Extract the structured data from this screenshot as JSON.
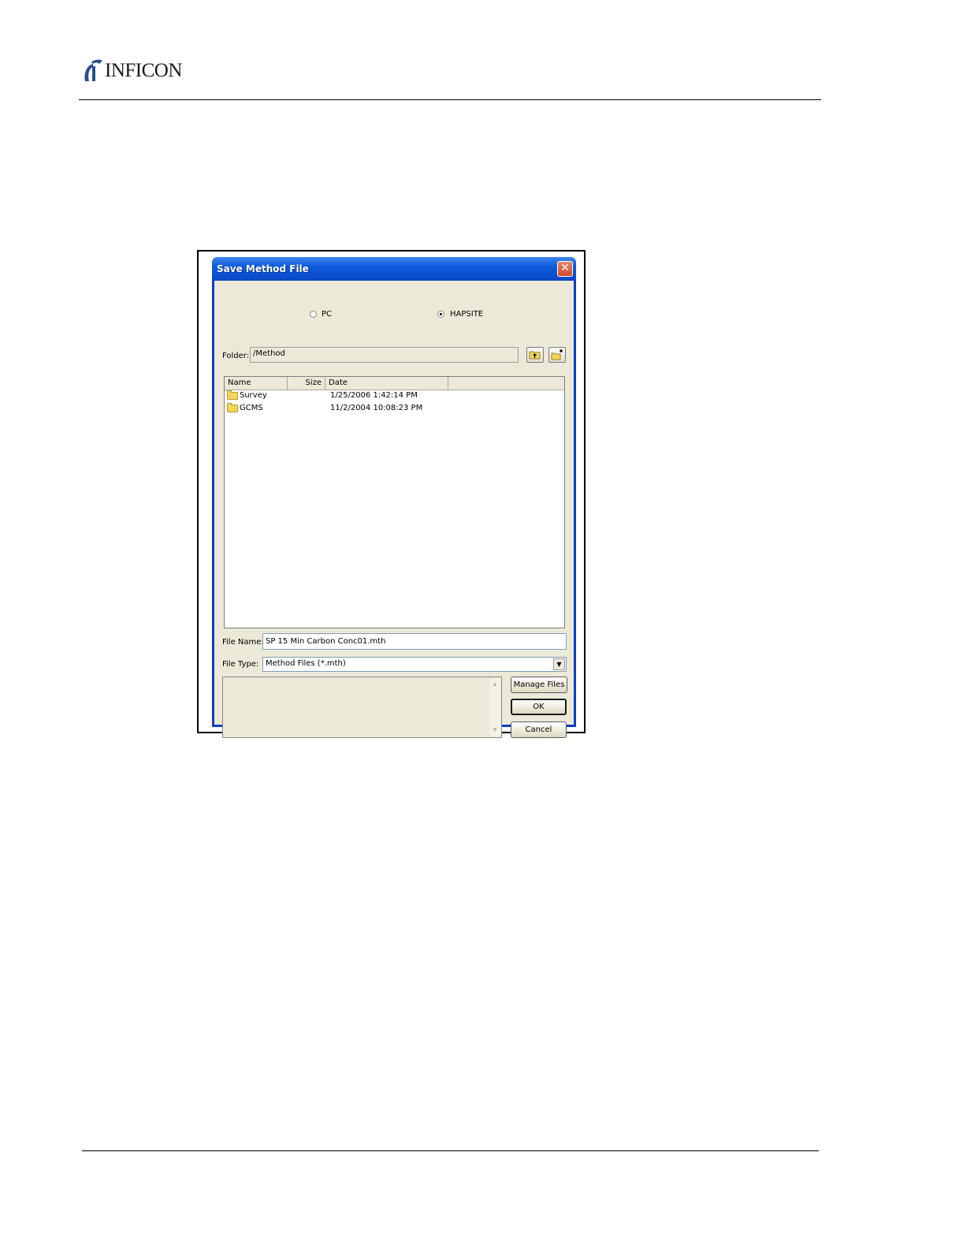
{
  "header": {
    "logo_text": "INFICON"
  },
  "dialog": {
    "title": "Save Method File",
    "close_glyph": "✕",
    "location": {
      "pc_label": "PC",
      "hapsite_label": "HAPSITE",
      "selected": "HAPSITE"
    },
    "folder": {
      "label": "Folder:",
      "value": "/Method",
      "up_icon": "folder-up-icon",
      "new_icon": "new-folder-icon"
    },
    "file_list": {
      "columns": [
        "Name",
        "Size",
        "Date"
      ],
      "rows": [
        {
          "name": "Survey",
          "size": "",
          "date": "1/25/2006 1:42:14 PM"
        },
        {
          "name": "GCMS",
          "size": "",
          "date": "11/2/2004 10:08:23 PM"
        }
      ]
    },
    "file_name": {
      "label": "File Name:",
      "value": "SP 15 Min Carbon Conc01.mth"
    },
    "file_type": {
      "label": "File Type:",
      "value": "Method Files (*.mth)"
    },
    "buttons": {
      "manage_files": "Manage Files",
      "ok": "OK",
      "cancel": "Cancel"
    }
  },
  "colors": {
    "titlebar": "#0a4fd0",
    "dialog_face": "#ece9d8",
    "close_button": "#d4472a",
    "logo_mark": "#2a4f8c"
  }
}
